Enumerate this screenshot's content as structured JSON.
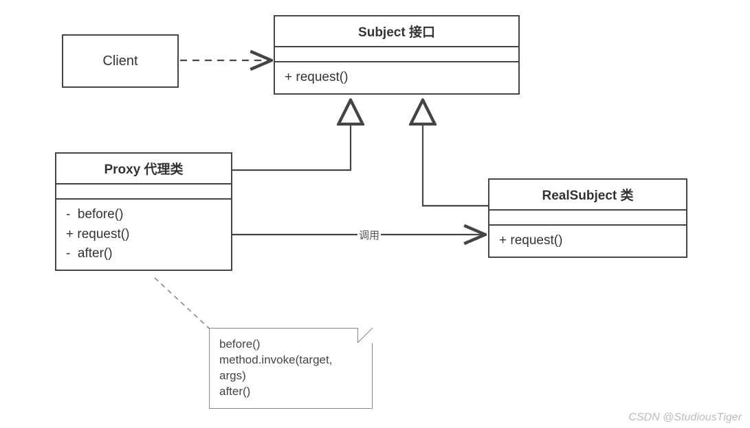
{
  "client": {
    "label": "Client"
  },
  "subject": {
    "title": "Subject 接口",
    "ops": [
      "+ request()"
    ]
  },
  "proxy": {
    "title": "Proxy 代理类",
    "ops": [
      "-  before()",
      "+ request()",
      "-  after()"
    ]
  },
  "realsubject": {
    "title": "RealSubject 类",
    "ops": [
      "+ request()"
    ]
  },
  "note": {
    "lines": [
      "before()",
      "method.invoke(target,",
      "args)",
      "after()"
    ]
  },
  "assoc": {
    "label": "调用"
  },
  "watermark": "CSDN @StudiousTiger"
}
